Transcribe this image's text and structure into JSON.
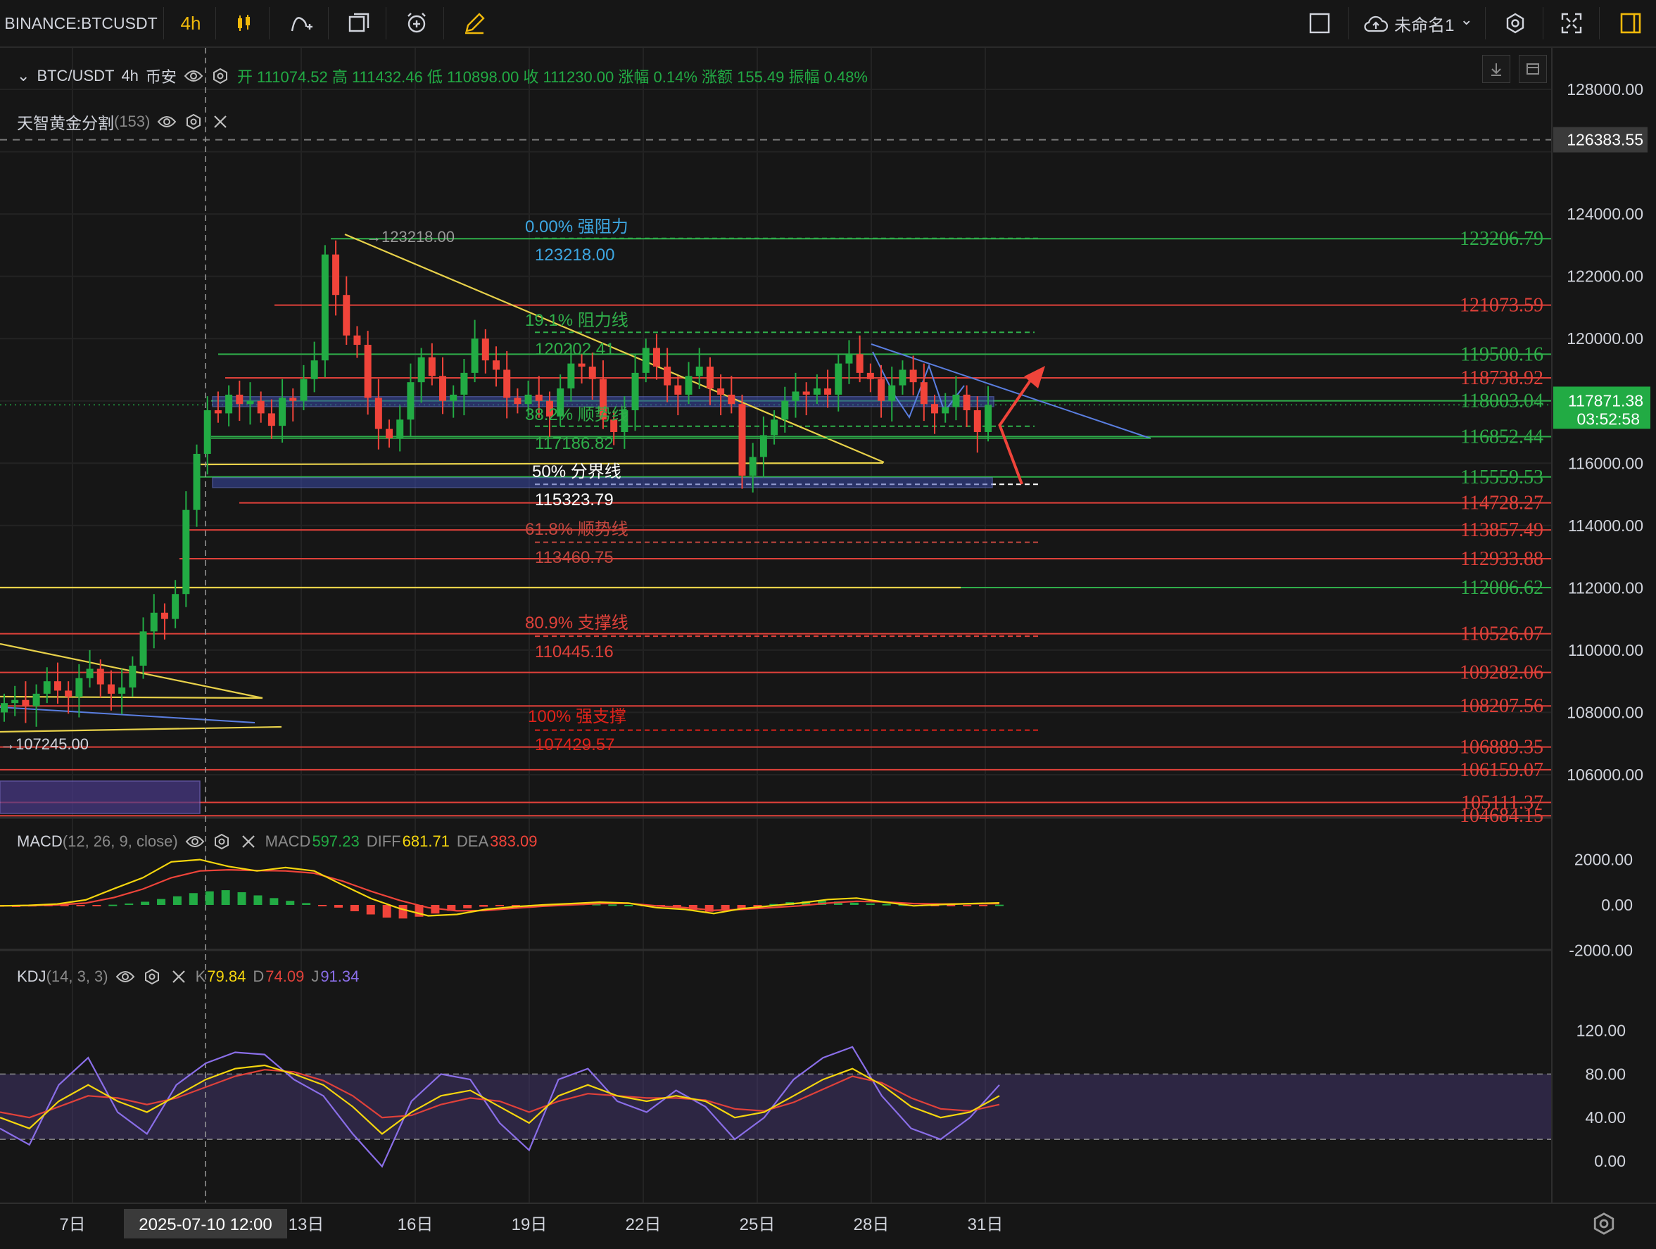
{
  "topbar": {
    "symbol": "BINANCE:BTCUSDT",
    "interval": "4h",
    "layout_name": "未命名1",
    "layout_chevron": "⌄"
  },
  "legend": {
    "symbol": "BTC/USDT",
    "interval": "4h",
    "exchange": "币安",
    "ohlc_text": "开 111074.52 高 111432.46 低 110898.00 收 111230.00 涨幅 0.14% 涨额 155.49 振幅 0.48%",
    "indicator_name": "天智黄金分割",
    "indicator_param": "(153)"
  },
  "macd": {
    "name": "MACD",
    "params": "(12, 26, 9, close)",
    "macd_label": "MACD",
    "macd_value": "597.23",
    "diff_label": "DIFF",
    "diff_value": "681.71",
    "dea_label": "DEA",
    "dea_value": "383.09"
  },
  "kdj": {
    "name": "KDJ",
    "params": "(14, 3, 3)",
    "k_label": "K",
    "k_value": "79.84",
    "d_label": "D",
    "d_value": "74.09",
    "j_label": "J",
    "j_value": "91.34"
  },
  "price_axis": {
    "ticks": [
      "128000.00",
      "124000.00",
      "122000.00",
      "120000.00",
      "116000.00",
      "114000.00",
      "112000.00",
      "110000.00",
      "108000.00",
      "106000.00"
    ],
    "high_marker": "126383.55",
    "current_price": "117871.38",
    "countdown": "03:52:58",
    "level_labels": [
      {
        "text": "123206.79",
        "color": "#2fae4a"
      },
      {
        "text": "121073.59",
        "color": "#e0413a"
      },
      {
        "text": "119500.16",
        "color": "#2fae4a"
      },
      {
        "text": "118738.92",
        "color": "#e0413a"
      },
      {
        "text": "118003.04",
        "color": "#2fae4a"
      },
      {
        "text": "116852.44",
        "color": "#2fae4a"
      },
      {
        "text": "115559.53",
        "color": "#2fae4a"
      },
      {
        "text": "114728.27",
        "color": "#e0413a"
      },
      {
        "text": "113857.49",
        "color": "#e0413a"
      },
      {
        "text": "112933.88",
        "color": "#e0413a"
      },
      {
        "text": "112006.62",
        "color": "#2fae4a"
      },
      {
        "text": "110526.07",
        "color": "#e0413a"
      },
      {
        "text": "109282.06",
        "color": "#e0413a"
      },
      {
        "text": "108207.56",
        "color": "#e0413a"
      },
      {
        "text": "106889.35",
        "color": "#e0413a"
      },
      {
        "text": "106159.07",
        "color": "#e0413a"
      },
      {
        "text": "105111.37",
        "color": "#e0413a"
      },
      {
        "text": "104684.15",
        "color": "#e0413a"
      }
    ]
  },
  "macd_axis": [
    "2000.00",
    "0.00",
    "-2000.00"
  ],
  "kdj_axis": [
    "120.00",
    "80.00",
    "40.00",
    "0.00"
  ],
  "time_axis": {
    "labels": [
      "7日",
      "13日",
      "16日",
      "19日",
      "22日",
      "25日",
      "28日",
      "31日"
    ],
    "crosshair_label": "2025-07-10  12:00"
  },
  "fib_annotations": [
    {
      "text": "0.00% 强阻力",
      "color": "#3da6e0"
    },
    {
      "text": "123218.00",
      "color": "#3da6e0"
    },
    {
      "text": "19.1% 阻力线",
      "color": "#2fae4a"
    },
    {
      "text": "120202.41",
      "color": "#2fae4a"
    },
    {
      "text": "38.2% 顺势线",
      "color": "#2fae4a"
    },
    {
      "text": "117186.82",
      "color": "#2fae4a"
    },
    {
      "text": "50% 分界线",
      "color": "#ffffff"
    },
    {
      "text": "115323.79",
      "color": "#ffffff"
    },
    {
      "text": "61.8% 顺势线",
      "color": "#c4473f"
    },
    {
      "text": "113460.75",
      "color": "#c4473f"
    },
    {
      "text": "80.9% 支撑线",
      "color": "#e0413a"
    },
    {
      "text": "110445.16",
      "color": "#e0413a"
    },
    {
      "text": "100% 强支撑",
      "color": "#e0221a"
    },
    {
      "text": "107429.57",
      "color": "#e0221a"
    }
  ],
  "chart_labels": {
    "swing_high": "→123218.00",
    "swing_low": "→107245.00"
  },
  "colors": {
    "up": "#22ab44",
    "down": "#f0443a",
    "background": "#161616",
    "current_price_bg": "#22ab44"
  },
  "chart_data": {
    "type": "candlestick",
    "symbol": "BTC/USDT",
    "interval": "4h",
    "ylim": [
      104500,
      129000
    ],
    "candles_close_approx": [
      108300,
      108400,
      108200,
      108600,
      109000,
      108700,
      108500,
      109100,
      109400,
      108900,
      108600,
      108800,
      109500,
      110600,
      111200,
      111000,
      111800,
      114500,
      116300,
      117700,
      117600,
      118200,
      117900,
      118000,
      117600,
      117200,
      118100,
      118000,
      118700,
      119300,
      122700,
      121400,
      120100,
      119800,
      118100,
      117100,
      116800,
      117400,
      118600,
      119400,
      118800,
      118000,
      118200,
      118900,
      120000,
      119300,
      119000,
      118100,
      117900,
      118200,
      118000,
      117500,
      118400,
      119200,
      119100,
      118700,
      117400,
      117000,
      117700,
      118900,
      119700,
      119100,
      118500,
      118200,
      118800,
      119100,
      118400,
      118200,
      117900,
      115600,
      116200,
      116900,
      117400,
      118000,
      118300,
      118200,
      118400,
      118200,
      119200,
      119500,
      118900,
      118700,
      118000,
      118500,
      119000,
      118600,
      117900,
      117600,
      117800,
      118200,
      117700,
      117000,
      117871
    ],
    "macd_histogram_approx": [
      -80,
      -90,
      -70,
      -60,
      -50,
      -40,
      -20,
      10,
      60,
      140,
      260,
      380,
      520,
      600,
      650,
      560,
      420,
      300,
      180,
      80,
      -20,
      -120,
      -280,
      -420,
      -560,
      -600,
      -520,
      -380,
      -260,
      -150,
      -80,
      -40,
      -20,
      0,
      20,
      40,
      50,
      40,
      20,
      0,
      -20,
      -40,
      -80,
      -220,
      -300,
      -260,
      -180,
      -80,
      40,
      120,
      160,
      180,
      150,
      100,
      60,
      40,
      20,
      0,
      -20,
      -40,
      -40,
      -20,
      10
    ],
    "macd_diff_approx": [
      -40,
      -20,
      40,
      220,
      720,
      1200,
      1900,
      2000,
      1700,
      1500,
      1650,
      1500,
      880,
      280,
      -160,
      -480,
      -420,
      -200,
      -80,
      0,
      60,
      120,
      80,
      -120,
      -200,
      -380,
      -160,
      -40,
      80,
      240,
      300,
      120,
      -40,
      20,
      60,
      90
    ],
    "macd_dea_approx": [
      -40,
      -30,
      0,
      80,
      330,
      700,
      1200,
      1500,
      1550,
      1520,
      1500,
      1400,
      1050,
      600,
      200,
      -120,
      -260,
      -250,
      -150,
      -60,
      0,
      60,
      70,
      -40,
      -120,
      -240,
      -200,
      -120,
      -40,
      80,
      160,
      130,
      60,
      40,
      50,
      60
    ],
    "kdj_k_approx": [
      40,
      30,
      55,
      70,
      55,
      45,
      60,
      75,
      85,
      88,
      80,
      70,
      50,
      25,
      45,
      60,
      65,
      50,
      35,
      60,
      70,
      60,
      55,
      60,
      55,
      40,
      45,
      60,
      75,
      85,
      70,
      50,
      40,
      45,
      60
    ],
    "kdj_d_approx": [
      45,
      40,
      50,
      60,
      58,
      52,
      58,
      68,
      78,
      84,
      82,
      74,
      60,
      40,
      42,
      52,
      58,
      55,
      45,
      55,
      62,
      60,
      58,
      58,
      56,
      48,
      46,
      54,
      66,
      78,
      72,
      58,
      48,
      46,
      52
    ],
    "kdj_j_approx": [
      30,
      15,
      70,
      95,
      45,
      25,
      70,
      90,
      100,
      98,
      75,
      60,
      25,
      -5,
      55,
      80,
      75,
      35,
      10,
      75,
      85,
      55,
      45,
      65,
      50,
      20,
      40,
      75,
      95,
      105,
      60,
      30,
      20,
      40,
      70
    ]
  }
}
